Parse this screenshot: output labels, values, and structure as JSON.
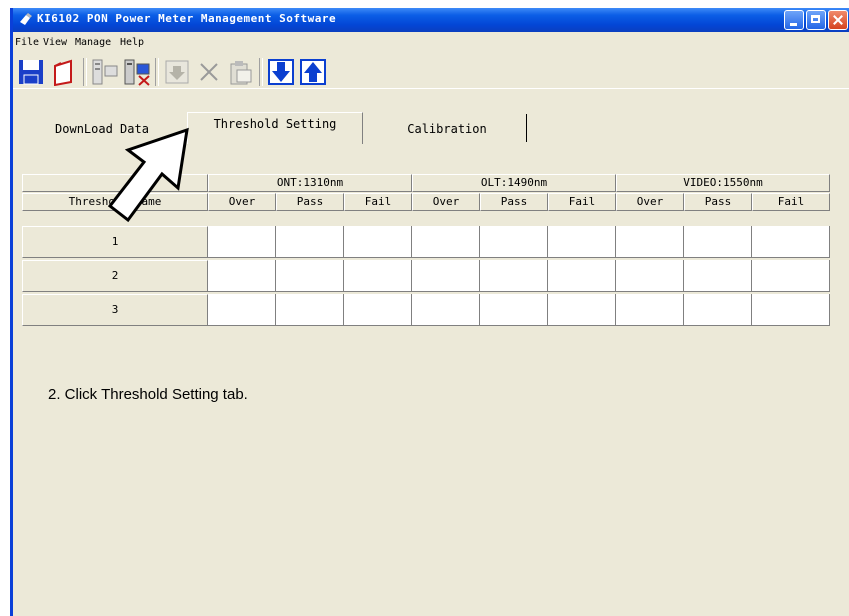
{
  "window": {
    "title": "KI6102 PON Power Meter Management Software"
  },
  "menubar": {
    "items": [
      "File",
      "View",
      "Manage",
      "Help"
    ]
  },
  "toolbar": {
    "buttons": [
      {
        "icon": "save-icon"
      },
      {
        "icon": "open-icon"
      },
      {
        "icon": "connect-icon"
      },
      {
        "icon": "disconnect-icon"
      },
      {
        "icon": "import-icon"
      },
      {
        "icon": "delete-icon"
      },
      {
        "icon": "clipboard-icon"
      },
      {
        "icon": "download-arrow-icon"
      },
      {
        "icon": "upload-arrow-icon"
      }
    ]
  },
  "tabs": {
    "items": [
      {
        "label": "DownLoad Data"
      },
      {
        "label": "Threshold Setting"
      },
      {
        "label": "Calibration"
      }
    ],
    "active": "Threshold Setting"
  },
  "table": {
    "groups": [
      "ONT:1310nm",
      "OLT:1490nm",
      "VIDEO:1550nm"
    ],
    "first_col_header": "Threshold Name",
    "sub_headers": [
      "Over",
      "Pass",
      "Fail"
    ],
    "rows": [
      {
        "name": "1",
        "values": [
          "",
          "",
          "",
          "",
          "",
          "",
          "",
          "",
          ""
        ]
      },
      {
        "name": "2",
        "values": [
          "",
          "",
          "",
          "",
          "",
          "",
          "",
          "",
          ""
        ]
      },
      {
        "name": "3",
        "values": [
          "",
          "",
          "",
          "",
          "",
          "",
          "",
          "",
          ""
        ]
      }
    ]
  },
  "caption": "2. Click Threshold Setting tab.",
  "colors": {
    "titlebar": "#0346d6",
    "window_bg": "#ece9d8",
    "toolbar_blue": "#0b3fd0"
  }
}
